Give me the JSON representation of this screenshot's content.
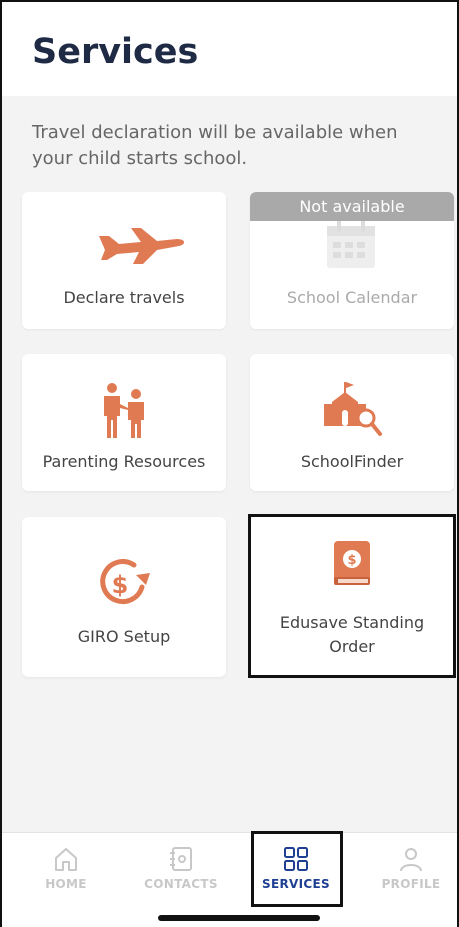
{
  "header": {
    "title": "Services"
  },
  "notice": "Travel declaration will be available when your child starts school.",
  "services": [
    {
      "label": "Declare travels",
      "icon": "airplane-icon",
      "available": true
    },
    {
      "label": "School Calendar",
      "icon": "calendar-icon",
      "available": false,
      "badge": "Not available"
    },
    {
      "label": "Parenting Resources",
      "icon": "parents-icon",
      "available": true
    },
    {
      "label": "SchoolFinder",
      "icon": "school-search-icon",
      "available": true
    },
    {
      "label": "GIRO Setup",
      "icon": "giro-dollar-icon",
      "available": true
    },
    {
      "label": "Edusave Standing Order",
      "icon": "edusave-book-icon",
      "available": true
    }
  ],
  "tabs": [
    {
      "label": "HOME",
      "icon": "home-icon",
      "active": false
    },
    {
      "label": "CONTACTS",
      "icon": "contacts-icon",
      "active": false
    },
    {
      "label": "SERVICES",
      "icon": "services-grid-icon",
      "active": true
    },
    {
      "label": "PROFILE",
      "icon": "profile-icon",
      "active": false
    }
  ],
  "colors": {
    "accent": "#e07a52",
    "title": "#1f2a44",
    "active_tab": "#1f3f93",
    "inactive_tab": "#c8c8c8",
    "badge": "#a9a9a9"
  }
}
